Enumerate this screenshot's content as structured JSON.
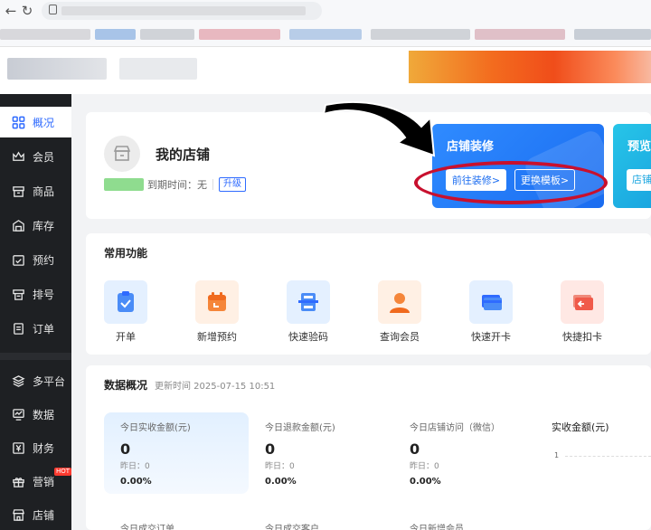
{
  "sidebar": {
    "items": [
      {
        "label": "概况",
        "icon": "grid-icon"
      },
      {
        "label": "会员",
        "icon": "crown-icon"
      },
      {
        "label": "商品",
        "icon": "box-icon"
      },
      {
        "label": "库存",
        "icon": "warehouse-icon"
      },
      {
        "label": "预约",
        "icon": "calendar-check-icon"
      },
      {
        "label": "排号",
        "icon": "queue-ticket-icon"
      },
      {
        "label": "订单",
        "icon": "order-icon"
      },
      {
        "label": "多平台",
        "icon": "layers-icon"
      },
      {
        "label": "数据",
        "icon": "monitor-chart-icon"
      },
      {
        "label": "财务",
        "icon": "yen-icon"
      },
      {
        "label": "营销",
        "icon": "gift-icon",
        "badge": "HOT"
      },
      {
        "label": "店铺",
        "icon": "store-icon"
      }
    ]
  },
  "shop": {
    "title": "我的店铺",
    "expiry_label": "到期时间：无",
    "upgrade": "升级"
  },
  "decoration": {
    "title": "店铺装修",
    "go_button": "前往装修>",
    "change_button": "更换模板>"
  },
  "preview": {
    "title": "预览",
    "button": "店铺"
  },
  "common_functions": {
    "title": "常用功能",
    "items": [
      {
        "label": "开单",
        "icon": "clipboard-check-icon",
        "color": "#4a8cf7"
      },
      {
        "label": "新增预约",
        "icon": "calendar-icon",
        "color": "#f5863a"
      },
      {
        "label": "快速验码",
        "icon": "scan-icon",
        "color": "#4a8cf7"
      },
      {
        "label": "查询会员",
        "icon": "user-icon",
        "color": "#f5863a"
      },
      {
        "label": "快速开卡",
        "icon": "card-icon",
        "color": "#4a8cf7"
      },
      {
        "label": "快捷扣卡",
        "icon": "card-deduct-icon",
        "color": "#f05a4a"
      }
    ]
  },
  "data_overview": {
    "title": "数据概况",
    "update_time": "更新时间 2025-07-15 10:51",
    "stats": [
      {
        "label": "今日实收金额(元)",
        "value": "0",
        "yesterday": "昨日：0",
        "percent": "0.00%"
      },
      {
        "label": "今日退款金额(元)",
        "value": "0",
        "yesterday": "昨日：0",
        "percent": "0.00%"
      },
      {
        "label": "今日店铺访问（微信）",
        "value": "0",
        "yesterday": "昨日：0",
        "percent": "0.00%"
      }
    ],
    "chart_label": "实收金额(元)",
    "chart_tick": "1",
    "bottom_labels": [
      "今日成交订单",
      "今日成交客户",
      "今日新增会员"
    ]
  }
}
